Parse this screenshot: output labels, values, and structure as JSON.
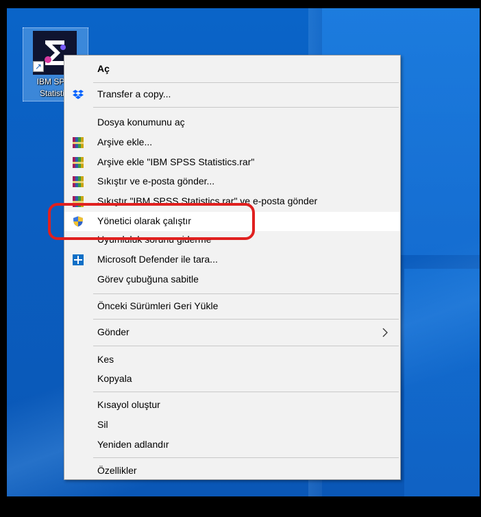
{
  "desktop": {
    "icon_label": "IBM SPSS\nStatistics"
  },
  "context_menu": {
    "items": [
      {
        "label": "Aç"
      },
      {
        "label": "Transfer a copy..."
      },
      {
        "label": "Dosya konumunu aç"
      },
      {
        "label": "Arşive ekle..."
      },
      {
        "label": "Arşive ekle \"IBM SPSS Statistics.rar\""
      },
      {
        "label": "Sıkıştır ve e-posta gönder..."
      },
      {
        "label": "Sıkıştır \"IBM SPSS Statistics.rar\" ve e-posta gönder"
      },
      {
        "label": "Yönetici olarak çalıştır"
      },
      {
        "label": "Uyumluluk sorunu giderme"
      },
      {
        "label": "Microsoft Defender ile tara..."
      },
      {
        "label": "Görev çubuğuna sabitle"
      },
      {
        "label": "Önceki Sürümleri Geri Yükle"
      },
      {
        "label": "Gönder"
      },
      {
        "label": "Kes"
      },
      {
        "label": "Kopyala"
      },
      {
        "label": "Kısayol oluştur"
      },
      {
        "label": "Sil"
      },
      {
        "label": "Yeniden adlandır"
      },
      {
        "label": "Özellikler"
      }
    ]
  },
  "colors": {
    "highlight_ring": "#e0201f",
    "desktop_blue": "#0a64c8",
    "menu_background": "#f2f2f2"
  }
}
